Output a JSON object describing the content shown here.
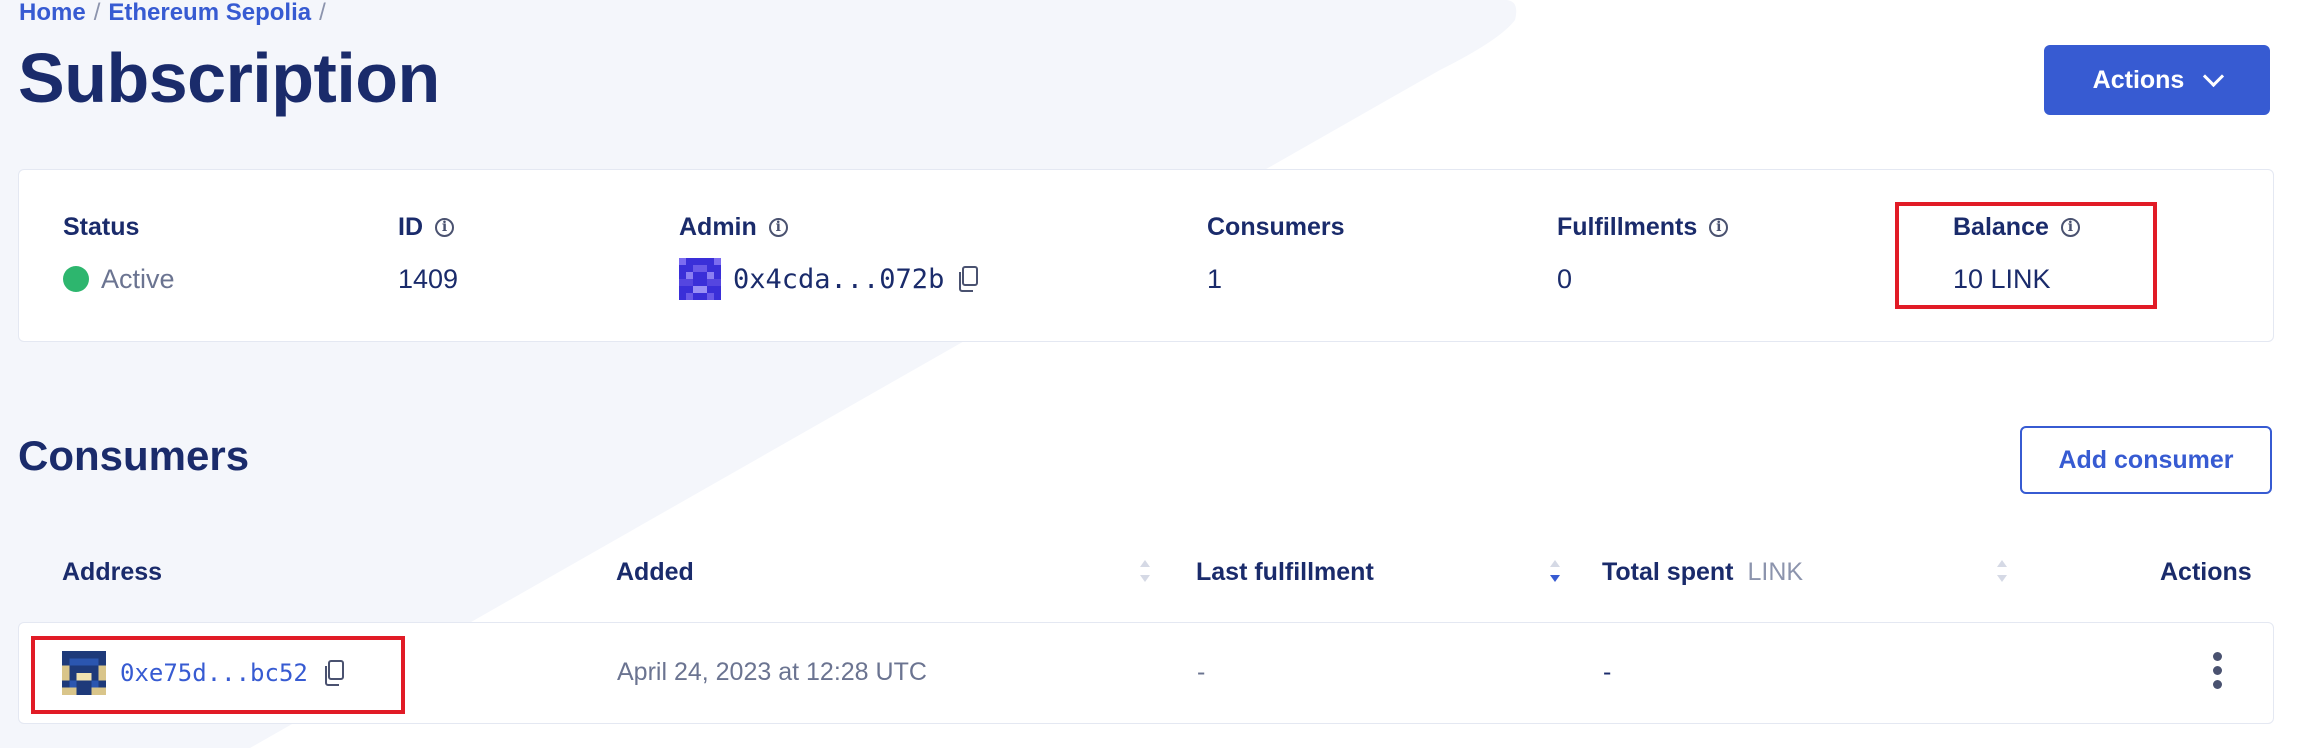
{
  "breadcrumb": {
    "home": "Home",
    "sep": "/",
    "network": "Ethereum Sepolia"
  },
  "page": {
    "title": "Subscription"
  },
  "header": {
    "actions_label": "Actions"
  },
  "summary": {
    "status_label": "Status",
    "status_value": "Active",
    "id_label": "ID",
    "id_value": "1409",
    "admin_label": "Admin",
    "admin_value": "0x4cda...072b",
    "consumers_label": "Consumers",
    "consumers_value": "1",
    "fulfillments_label": "Fulfillments",
    "fulfillments_value": "0",
    "balance_label": "Balance",
    "balance_value": "10 LINK"
  },
  "consumers": {
    "title": "Consumers",
    "add_label": "Add consumer",
    "columns": {
      "address": "Address",
      "added": "Added",
      "last_fulfillment": "Last fulfillment",
      "total_spent": "Total spent",
      "total_spent_unit": "LINK",
      "actions": "Actions"
    },
    "rows": [
      {
        "address": "0xe75d...bc52",
        "added": "April 24, 2023 at 12:28 UTC",
        "last_fulfillment": "-",
        "total_spent": "-"
      }
    ]
  },
  "icons": {
    "info": "info-icon",
    "copy": "copy-icon",
    "chevron": "chevron-down-icon",
    "sort": "sort-icon",
    "kebab": "more-vertical-icon"
  },
  "colors": {
    "brand": "#375bd2",
    "text": "#1a2b6b",
    "status_active": "#2db66e",
    "highlight": "#e11b26"
  }
}
